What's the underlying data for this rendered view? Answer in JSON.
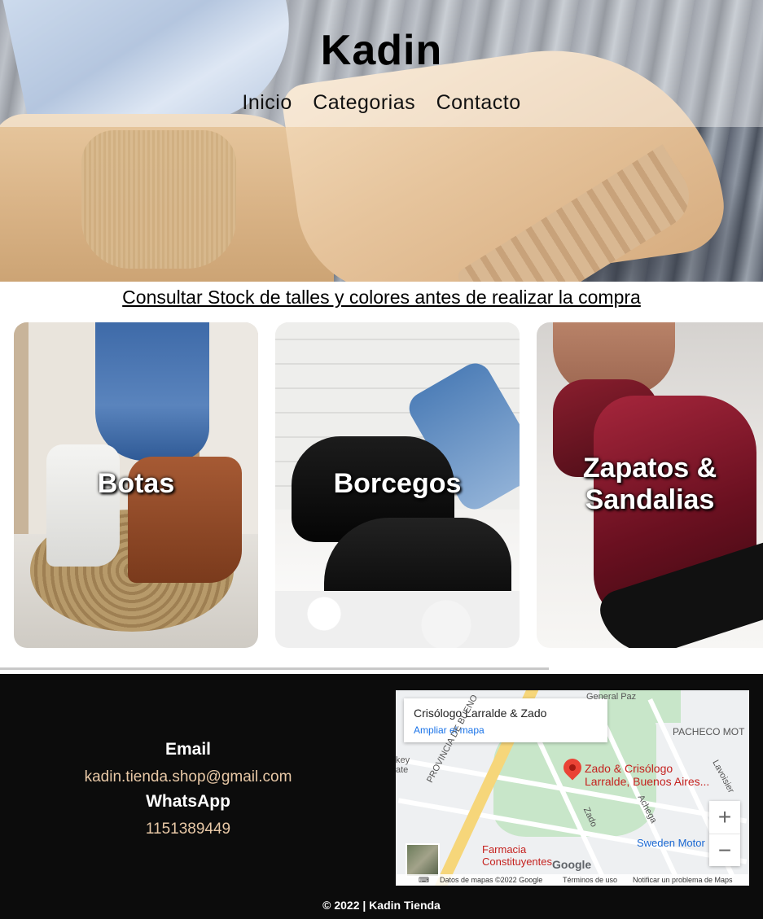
{
  "header": {
    "title": "Kadin",
    "nav": [
      "Inicio",
      "Categorias",
      "Contacto"
    ]
  },
  "notice": "Consultar Stock de talles y colores antes de realizar la compra",
  "categories": [
    {
      "label": "Botas"
    },
    {
      "label": "Borcegos"
    },
    {
      "label": "Zapatos & Sandalias"
    }
  ],
  "contact": {
    "email_heading": "Email",
    "email": "kadin.tienda.shop@gmail.com",
    "whatsapp_heading": "WhatsApp",
    "whatsapp": "1151389449"
  },
  "map": {
    "place_title": "Crisólogo Larralde & Zado",
    "expand_link": "Ampliar el mapa",
    "pin_label": "Zado & Crisólogo Larralde, Buenos Aires...",
    "street_labels": [
      "General Paz",
      "PACHECO MOT",
      "PROVINCIA DE BUENO",
      "Zado",
      "Achega",
      "Lavoisier",
      "key",
      "ate"
    ],
    "poi_pharmacy": "Farmacia Constituyentes",
    "poi_motor": "Sweden Motor",
    "google_logo": "Google",
    "attribution": [
      "Datos de mapas ©2022 Google",
      "Términos de uso",
      "Notificar un problema de Maps"
    ],
    "zoom_in": "+",
    "zoom_out": "−"
  },
  "footer": {
    "copyright": "© 2022 | Kadin Tienda"
  },
  "colors": {
    "footer_bg": "#0c0c0c",
    "contact_value": "#e8c8a6",
    "divider": "#c8c8c8"
  }
}
